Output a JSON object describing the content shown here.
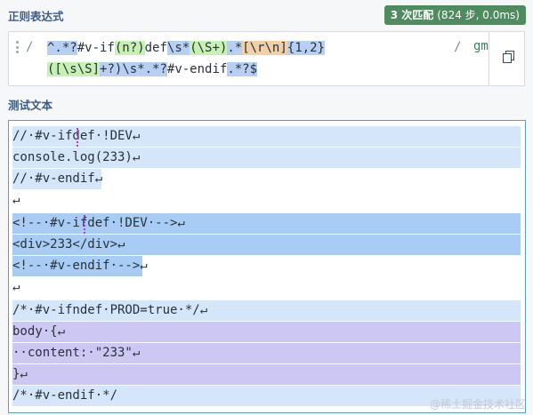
{
  "regex_section": {
    "title": "正则表达式",
    "badge_count": "3 次匹配",
    "badge_detail": "(824 步, 0.0ms)",
    "open_delim": "/",
    "close_delim": "/",
    "flags": "gm",
    "line1": [
      "^.*?",
      "#v-if",
      "(n?)",
      "def",
      "\\s*",
      "(\\S+)",
      ".*",
      "[\\r\\n]",
      "{1,2}"
    ],
    "line2": [
      "([\\s\\S]",
      "+?)",
      "\\s*.*?",
      "#v-endif",
      ".*?$"
    ]
  },
  "test_section": {
    "title": "测试文本",
    "lines": [
      "//·#v-ifdef·!DEV↵",
      "console.log(233)↵",
      "//·#v-endif↵",
      "↵",
      "<!--·#v-ifdef·!DEV·-->↵",
      "<div>233</div>↵",
      "<!--·#v-endif·-->↵",
      "↵",
      "/*·#v-ifndef·PROD=true·*/↵",
      "body·{↵",
      "··content:·\"233\"↵",
      "}↵",
      "/*·#v-endif·*/"
    ]
  },
  "watermark": "@稀土掘金技术社区",
  "colors": {
    "accent": "#3c5c86",
    "badge": "#4e8b5f",
    "match_light": "#d6e6fa",
    "match_dark": "#a9ccf5",
    "group_purple": "#cdc7f3",
    "group_orange": "#f3d09e",
    "group_green": "#cfedbc"
  },
  "icons": [
    "drag-grip-icon",
    "copy-icon"
  ]
}
